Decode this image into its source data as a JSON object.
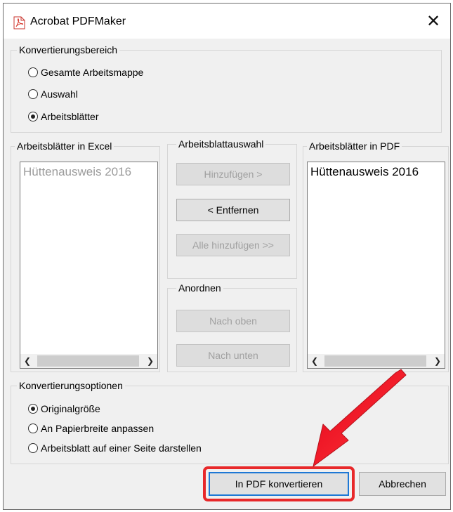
{
  "window": {
    "title": "Acrobat PDFMaker",
    "close_glyph": "✕"
  },
  "range_group": {
    "legend": "Konvertierungsbereich",
    "options": [
      {
        "label": "Gesamte Arbeitsmappe",
        "checked": false
      },
      {
        "label": "Auswahl",
        "checked": false
      },
      {
        "label": "Arbeitsblätter",
        "checked": true
      }
    ]
  },
  "excel_list": {
    "label": "Arbeitsblätter in Excel",
    "items": [
      "Hüttenausweis 2016"
    ]
  },
  "selection_group": {
    "legend": "Arbeitsblattauswahl",
    "add_label": "Hinzufügen >",
    "remove_label": "< Entfernen",
    "add_all_label": "Alle hinzufügen >>"
  },
  "arrange_group": {
    "legend": "Anordnen",
    "up_label": "Nach oben",
    "down_label": "Nach unten"
  },
  "pdf_list": {
    "label": "Arbeitsblätter in PDF",
    "items": [
      "Hüttenausweis 2016"
    ]
  },
  "options_group": {
    "legend": "Konvertierungsoptionen",
    "options": [
      {
        "label": "Originalgröße",
        "checked": true
      },
      {
        "label": "An Papierbreite anpassen",
        "checked": false
      },
      {
        "label": "Arbeitsblatt auf einer Seite darstellen",
        "checked": false
      }
    ]
  },
  "footer": {
    "convert_label": "In PDF konvertieren",
    "cancel_label": "Abbrechen"
  },
  "colors": {
    "annotation": "#e8282a",
    "focus": "#1e78d5",
    "disabled_text": "#a0a0a0",
    "dialog_bg": "#f0f0f0"
  },
  "scroll_glyphs": {
    "left": "❮",
    "right": "❯"
  }
}
